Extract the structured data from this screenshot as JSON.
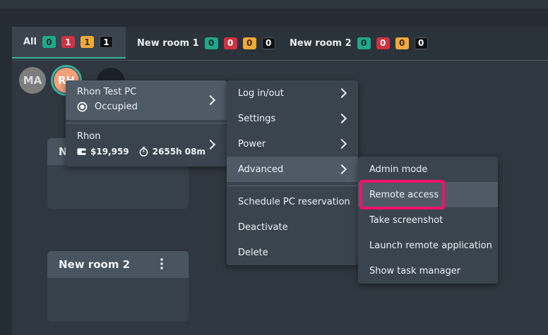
{
  "tabs": [
    {
      "label": "All",
      "badges": [
        "0",
        "1",
        "1",
        "1"
      ]
    },
    {
      "label": "New room 1",
      "badges": [
        "0",
        "0",
        "0",
        "0"
      ]
    },
    {
      "label": "New room 2",
      "badges": [
        "0",
        "0",
        "0",
        "0"
      ]
    }
  ],
  "avatars": [
    {
      "initials": "MA",
      "color": "#7d7d7d"
    },
    {
      "initials": "RH",
      "color": "#f4a07a"
    }
  ],
  "rooms": [
    {
      "title": "New room 1",
      "visible_prefix": "N"
    },
    {
      "title": "New room 2"
    }
  ],
  "pc_menu": {
    "pc_name": "Rhon Test PC",
    "status": "Occupied",
    "user_name": "Rhon",
    "balance": "$19,959",
    "time": "2655h 08m"
  },
  "actions_menu": {
    "items": [
      "Log in/out",
      "Settings",
      "Power",
      "Advanced"
    ],
    "items2": [
      "Schedule PC reservation",
      "Deactivate",
      "Delete"
    ]
  },
  "advanced_menu": {
    "items": [
      "Admin mode",
      "Remote access",
      "Take screenshot",
      "Launch remote application",
      "Show task manager"
    ]
  },
  "colors": {
    "accent": "#37b39e",
    "highlight": "#f0136c"
  },
  "icons": [
    "radio-selected-icon",
    "wallet-icon",
    "stopwatch-icon",
    "chevron-right-icon",
    "kebab-menu-icon"
  ]
}
